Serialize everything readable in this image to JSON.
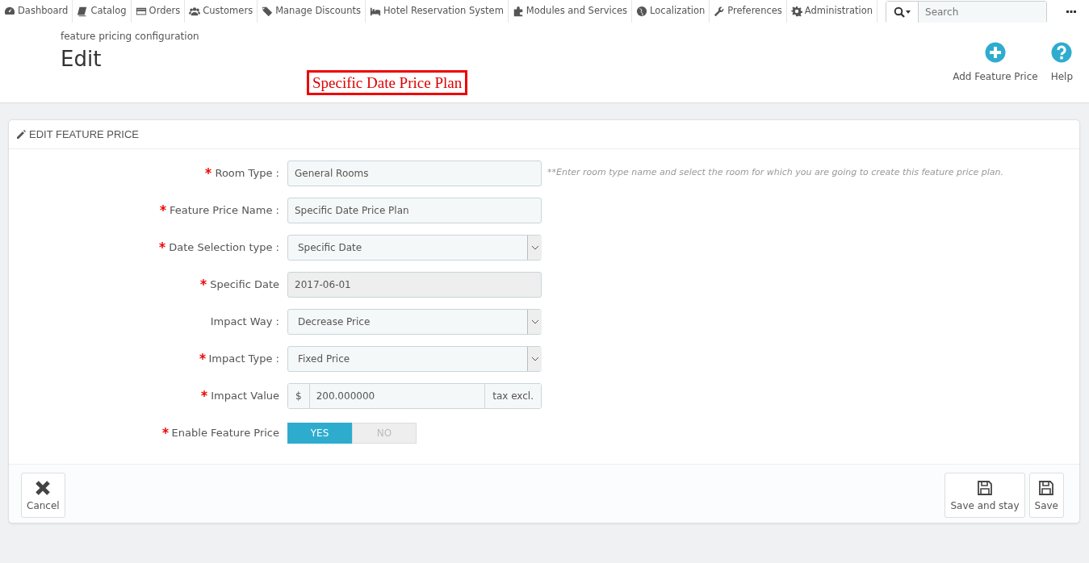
{
  "nav": [
    {
      "label": "Dashboard"
    },
    {
      "label": "Catalog"
    },
    {
      "label": "Orders"
    },
    {
      "label": "Customers"
    },
    {
      "label": "Manage Discounts"
    },
    {
      "label": "Hotel Reservation System"
    },
    {
      "label": "Modules and Services"
    },
    {
      "label": "Localization"
    },
    {
      "label": "Preferences"
    },
    {
      "label": "Administration"
    }
  ],
  "search": {
    "placeholder": "Search"
  },
  "header": {
    "breadcrumb": "feature pricing configuration",
    "title": "Edit",
    "annotation": "Specific Date Price Plan",
    "actions": [
      {
        "label": "Add Feature Price"
      },
      {
        "label": "Help"
      }
    ]
  },
  "panel": {
    "title": "EDIT FEATURE PRICE",
    "fields": [
      {
        "kind": "text",
        "label": "Room Type :",
        "required": true,
        "value": "General Rooms",
        "hint": "**Enter room type name and select the room for which you are going to create this feature price plan."
      },
      {
        "kind": "text",
        "label": "Feature Price Name :",
        "required": true,
        "value": "Specific Date Price Plan"
      },
      {
        "kind": "select",
        "label": "Date Selection type :",
        "required": true,
        "value": "Specific Date"
      },
      {
        "kind": "text",
        "label": "Specific Date",
        "required": true,
        "value": "2017-06-01",
        "disabled": true
      },
      {
        "kind": "select",
        "label": "Impact Way :",
        "required": false,
        "value": "Decrease Price"
      },
      {
        "kind": "select",
        "label": "Impact Type :",
        "required": true,
        "value": "Fixed Price"
      },
      {
        "kind": "money",
        "label": "Impact Value",
        "required": true,
        "prefix": "$",
        "value": "200.000000",
        "suffix": "tax excl."
      },
      {
        "kind": "toggle",
        "label": "Enable Feature Price",
        "required": true,
        "options": [
          {
            "label": "YES",
            "selected": true
          },
          {
            "label": "NO",
            "selected": false
          }
        ]
      }
    ],
    "footer": [
      {
        "label": "Cancel"
      },
      {
        "label": "Save and stay"
      },
      {
        "label": "Save"
      }
    ]
  }
}
